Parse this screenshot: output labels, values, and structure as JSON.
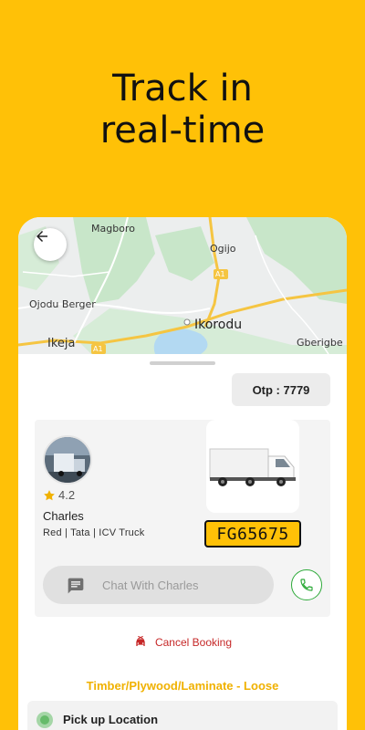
{
  "headline": {
    "line1": "Track in",
    "line2": "real-time"
  },
  "map": {
    "labels": {
      "magboro": "Magboro",
      "ogijo": "Ogijo",
      "a1_top": "A1",
      "ojodu": "Ojodu Berger",
      "ikorodu": "Ikorodu",
      "ikeja": "Ikeja",
      "a1_bottom": "A1",
      "gberigbe": "Gberigbe"
    }
  },
  "booking": {
    "otp": "Otp : 7779",
    "driver": {
      "rating": "4.2",
      "name": "Charles",
      "vehicle": "Red | Tata | ICV Truck",
      "plate": "FG65675"
    },
    "chat_placeholder": "Chat With Charles",
    "cancel_label": "Cancel Booking",
    "category": "Timber/Plywood/Laminate - Loose",
    "pickup_label": "Pick up Location"
  },
  "colors": {
    "brand": "#FFC107",
    "cancel": "#C62828",
    "call": "#2EAA3A",
    "category": "#F0B100"
  },
  "icons": [
    "back-arrow-icon",
    "star-icon",
    "chat-icon",
    "phone-icon",
    "car-cancel-icon"
  ]
}
